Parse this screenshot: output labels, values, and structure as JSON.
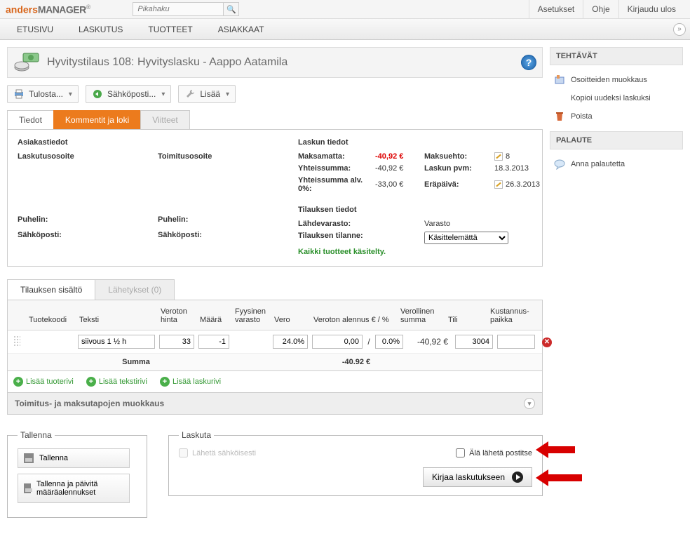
{
  "top": {
    "logo_a": "anders",
    "logo_b": "MANAGER",
    "search_placeholder": "Pikahaku",
    "links": [
      "Asetukset",
      "Ohje",
      "Kirjaudu ulos"
    ]
  },
  "nav": [
    "ETUSIVU",
    "LASKUTUS",
    "TUOTTEET",
    "ASIAKKAAT"
  ],
  "page_title": "Hyvitystilaus 108: Hyvityslasku - Aappo Aatamila",
  "toolbar": {
    "print": "Tulosta...",
    "email": "Sähköposti...",
    "more": "Lisää"
  },
  "tabs": [
    "Tiedot",
    "Kommentit ja loki",
    "Viitteet"
  ],
  "customer": {
    "heading": "Asiakastiedot",
    "billing_label": "Laskutusosoite",
    "shipping_label": "Toimitusosoite",
    "phone_label": "Puhelin:",
    "email_label": "Sähköposti:"
  },
  "invoice": {
    "heading": "Laskun tiedot",
    "unpaid_label": "Maksamatta:",
    "unpaid_value": "-40,92 €",
    "total_label": "Yhteissumma:",
    "total_value": "-40,92 €",
    "total0_label": "Yhteissumma alv. 0%:",
    "total0_value": "-33,00 €",
    "terms_label": "Maksuehto:",
    "terms_value": "8",
    "date_label": "Laskun pvm:",
    "date_value": "18.3.2013",
    "due_label": "Eräpäivä:",
    "due_value": "26.3.2013"
  },
  "order": {
    "heading": "Tilauksen tiedot",
    "warehouse_label": "Lähdevarasto:",
    "warehouse_value": "Varasto",
    "status_label": "Tilauksen tilanne:",
    "status_value": "Käsittelemättä",
    "all_handled": "Kaikki tuotteet käsitelty."
  },
  "subtabs": {
    "content": "Tilauksen sisältö",
    "shipments": "Lähetykset (0)"
  },
  "grid": {
    "head": {
      "code": "Tuotekoodi",
      "text": "Teksti",
      "price": "Veroton hinta",
      "qty": "Määrä",
      "stock": "Fyysinen varasto",
      "vat": "Vero",
      "disc": "Veroton alennus € / %",
      "line": "Verollinen summa",
      "acc": "Tili",
      "cost": "Kustannus-paikka"
    },
    "row": {
      "text": "siivous 1 ½ h",
      "price": "33",
      "qty": "-1",
      "vat": "24.0%",
      "disc_e": "0,00",
      "disc_p": "0.0%",
      "line": "-40,92 €",
      "acc": "3004"
    },
    "sum_label": "Summa",
    "sum_value": "-40.92 €",
    "add_product": "Lisää tuoterivi",
    "add_text": "Lisää tekstirivi",
    "add_invoice": "Lisää laskurivi"
  },
  "collapse_title": "Toimitus- ja maksutapojen muokkaus",
  "save": {
    "legend": "Tallenna",
    "save": "Tallenna",
    "save_update": "Tallenna ja päivitä määräalennukset"
  },
  "bill": {
    "legend": "Laskuta",
    "send_e": "Lähetä sähköisesti",
    "no_post": "Älä lähetä postitse",
    "book": "Kirjaa laskutukseen"
  },
  "side": {
    "tasks": "TEHTÄVÄT",
    "items": [
      "Osoitteiden muokkaus",
      "Kopioi uudeksi laskuksi",
      "Poista"
    ],
    "feedback": "PALAUTE",
    "feedback_item": "Anna palautetta"
  }
}
